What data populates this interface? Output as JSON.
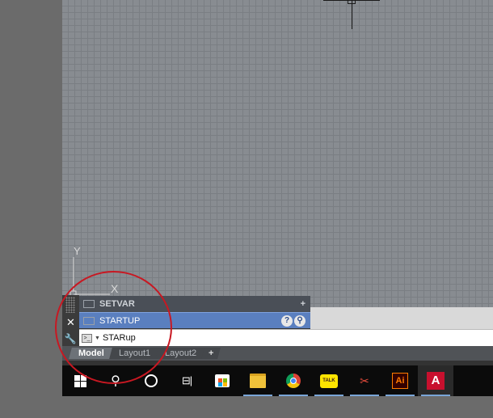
{
  "command_history": [
    {
      "label": "SETVAR"
    },
    {
      "label": "STARTUP"
    }
  ],
  "command_line": {
    "value": "STARup",
    "help_glyph": "?"
  },
  "ucs": {
    "y_label": "Y",
    "x_label": "X"
  },
  "layout_tabs": [
    {
      "label": "Model",
      "active": true
    },
    {
      "label": "Layout1",
      "active": false
    },
    {
      "label": "Layout2",
      "active": false
    }
  ],
  "add_tab_label": "+",
  "taskbar": {
    "talk_label": "TALK",
    "ai_label": "Ai",
    "acad_label": "A"
  },
  "colors": {
    "canvas": "#888c91",
    "highlight": "#5a7fbf",
    "annotation": "#c81822",
    "autocad_red": "#c8102e"
  }
}
